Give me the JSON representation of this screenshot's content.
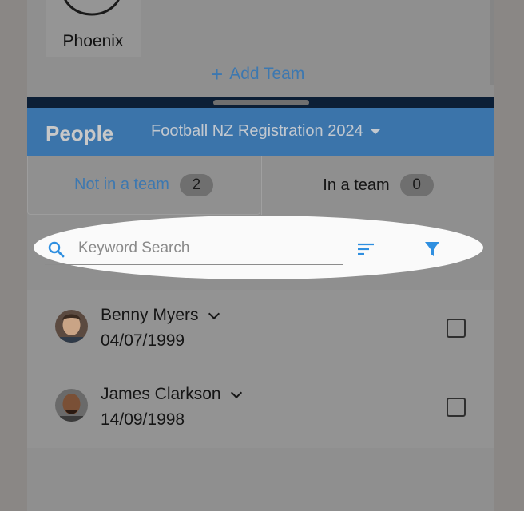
{
  "teams": {
    "items": [
      {
        "name": "Phoenix"
      }
    ],
    "add_team_label": "Add Team"
  },
  "people": {
    "title": "People",
    "competition": "Football NZ Registration 2024",
    "tabs": [
      {
        "label": "Not in a team",
        "count": "2",
        "active": true
      },
      {
        "label": "In a team",
        "count": "0",
        "active": false
      }
    ],
    "search": {
      "placeholder": "Keyword Search",
      "value": ""
    },
    "list": [
      {
        "name": "Benny Myers",
        "dob": "04/07/1999",
        "checked": false
      },
      {
        "name": "James Clarkson",
        "dob": "14/09/1998",
        "checked": false
      }
    ]
  },
  "colors": {
    "accent": "#3d78b0",
    "header": "#3b74aa",
    "filter": "#2f8fe0",
    "divider": "#0c1f36"
  },
  "icons": [
    "team-logo-icon",
    "plus-icon",
    "caret-down-icon",
    "search-icon",
    "sort-icon",
    "filter-icon",
    "chevron-down-icon",
    "checkbox-icon"
  ]
}
